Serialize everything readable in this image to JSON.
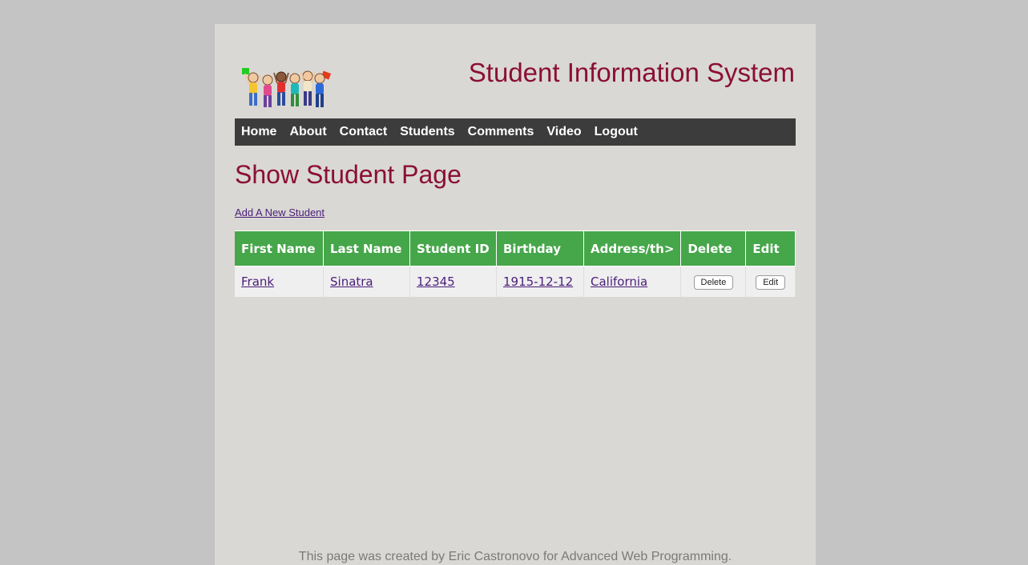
{
  "header": {
    "title": "Student Information System",
    "logo_icon": "jumping-students-logo"
  },
  "nav": {
    "items": [
      {
        "label": "Home"
      },
      {
        "label": "About"
      },
      {
        "label": "Contact"
      },
      {
        "label": "Students"
      },
      {
        "label": "Comments"
      },
      {
        "label": "Video"
      },
      {
        "label": "Logout"
      }
    ]
  },
  "main": {
    "heading": "Show Student Page",
    "add_link": "Add A New Student",
    "table": {
      "columns": [
        "First Name",
        "Last Name",
        "Student ID",
        "Birthday",
        "Address/th>",
        "Delete",
        "Edit"
      ],
      "rows": [
        {
          "first_name": "Frank",
          "last_name": "Sinatra",
          "student_id": "12345",
          "birthday": "1915-12-12",
          "address": "California",
          "delete_label": "Delete",
          "edit_label": "Edit"
        }
      ]
    }
  },
  "footer": {
    "text": "This page was created by Eric Castronovo for Advanced Web Programming."
  },
  "colors": {
    "background": "#c4c4c4",
    "page": "#d9d8d4",
    "accent": "#8b0f36",
    "nav": "#3c3c3c",
    "table_header": "#46a64a",
    "link": "#4b1d7a"
  }
}
